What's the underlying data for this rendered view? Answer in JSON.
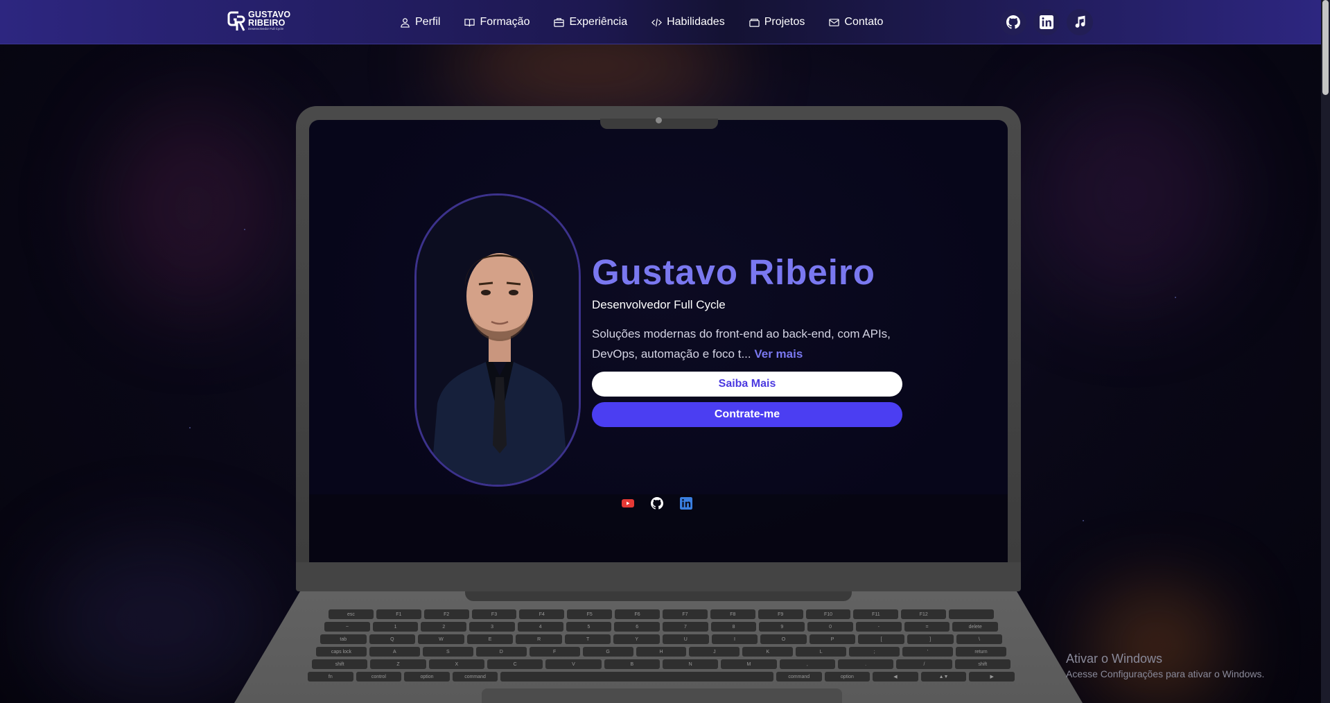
{
  "logo": {
    "line1": "GUSTAVO",
    "line2": "RIBEIRO",
    "tagline": "Desenvolvedor Full Cycle"
  },
  "nav": {
    "items": [
      {
        "label": "Perfil",
        "icon": "user-icon"
      },
      {
        "label": "Formação",
        "icon": "book-icon"
      },
      {
        "label": "Experiência",
        "icon": "briefcase-icon"
      },
      {
        "label": "Habilidades",
        "icon": "code-icon"
      },
      {
        "label": "Projetos",
        "icon": "folder-icon"
      },
      {
        "label": "Contato",
        "icon": "mail-icon"
      }
    ],
    "social": [
      "github-icon",
      "linkedin-icon",
      "music-icon"
    ]
  },
  "hero": {
    "name": "Gustavo Ribeiro",
    "role": "Desenvolvedor Full Cycle",
    "description": "Soluções modernas do front-end ao back-end, com APIs, DevOps, automação e foco t...",
    "more_link": "Ver mais",
    "primary_button": "Saiba Mais",
    "secondary_button": "Contrate-me",
    "socials": [
      "youtube-icon",
      "github-icon",
      "linkedin-icon"
    ]
  },
  "keyboard": {
    "row1": [
      "esc",
      "F1",
      "F2",
      "F3",
      "F4",
      "F5",
      "F6",
      "F7",
      "F8",
      "F9",
      "F10",
      "F11",
      "F12",
      ""
    ],
    "row2": [
      "~",
      "1",
      "2",
      "3",
      "4",
      "5",
      "6",
      "7",
      "8",
      "9",
      "0",
      "-",
      "=",
      "delete"
    ],
    "row3": [
      "tab",
      "Q",
      "W",
      "E",
      "R",
      "T",
      "Y",
      "U",
      "I",
      "O",
      "P",
      "[",
      "]",
      "\\"
    ],
    "row4": [
      "caps lock",
      "A",
      "S",
      "D",
      "F",
      "G",
      "H",
      "J",
      "K",
      "L",
      ";",
      "'",
      "return"
    ],
    "row5": [
      "shift",
      "Z",
      "X",
      "C",
      "V",
      "B",
      "N",
      "M",
      ",",
      ".",
      "/",
      "shift"
    ],
    "row6": [
      "fn",
      "control",
      "option",
      "command",
      "",
      "command",
      "option",
      "◀",
      "▲▼",
      "▶"
    ]
  },
  "windows_watermark": {
    "title": "Ativar o Windows",
    "subtitle": "Acesse Configurações para ativar o Windows."
  },
  "colors": {
    "accent": "#7a78f0",
    "button_primary_bg": "#ffffff",
    "button_primary_text": "#4b39e0",
    "button_secondary_bg": "#4b3ef2",
    "nav_bg": "#2d2680",
    "youtube": "#e53935",
    "linkedin": "#3a7fe0"
  }
}
